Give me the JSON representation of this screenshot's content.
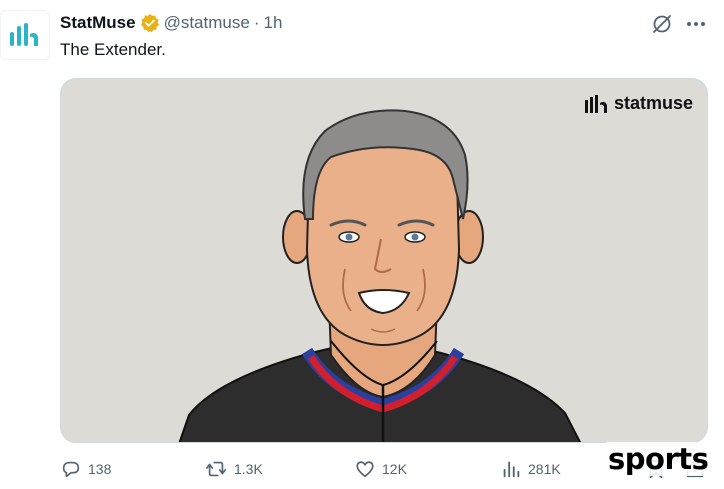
{
  "post": {
    "author_name": "StatMuse",
    "handle": "@statmuse",
    "separator": "·",
    "time": "1h",
    "text": "The Extender."
  },
  "media": {
    "watermark_text": "statmuse"
  },
  "actions": {
    "replies": "138",
    "reposts": "1.3K",
    "likes": "12K",
    "views": "281K"
  },
  "overlay": {
    "sports_logo": "sports"
  },
  "colors": {
    "verified_badge": "#e8b215",
    "avatar_brand": "#2bb3c8",
    "secondary_text": "#536471",
    "media_background": "#dcdbd5"
  },
  "icons": {
    "reply": "reply-icon",
    "repost": "repost-icon",
    "like": "heart-icon",
    "views": "views-icon",
    "bookmark": "bookmark-icon",
    "share": "share-icon",
    "grok": "grok-icon",
    "more": "more-icon",
    "verified": "verified-badge-icon"
  }
}
